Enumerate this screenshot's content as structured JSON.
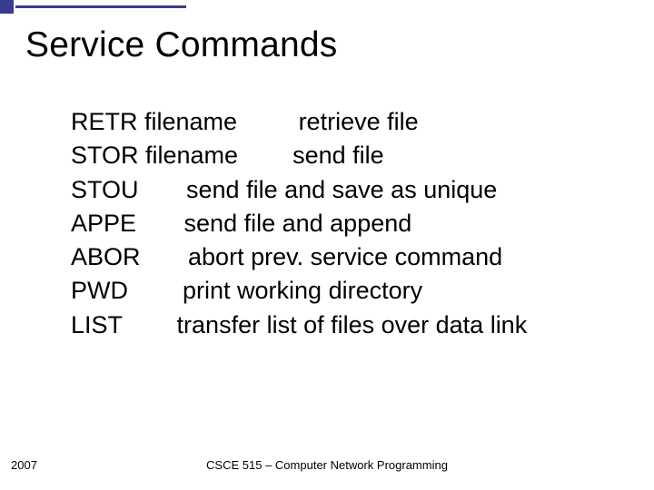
{
  "title": "Service Commands",
  "lines": {
    "l0": "RETR filename         retrieve file",
    "l1": "STOR filename        send file",
    "l2": "STOU       send file and save as unique",
    "l3": "APPE       send file and append",
    "l4": "ABOR       abort prev. service command",
    "l5": "PWD        print working directory",
    "l6": "LIST        transfer list of files over data link"
  },
  "footer": {
    "year": "2007",
    "course": "CSCE 515 – Computer Network Programming"
  }
}
